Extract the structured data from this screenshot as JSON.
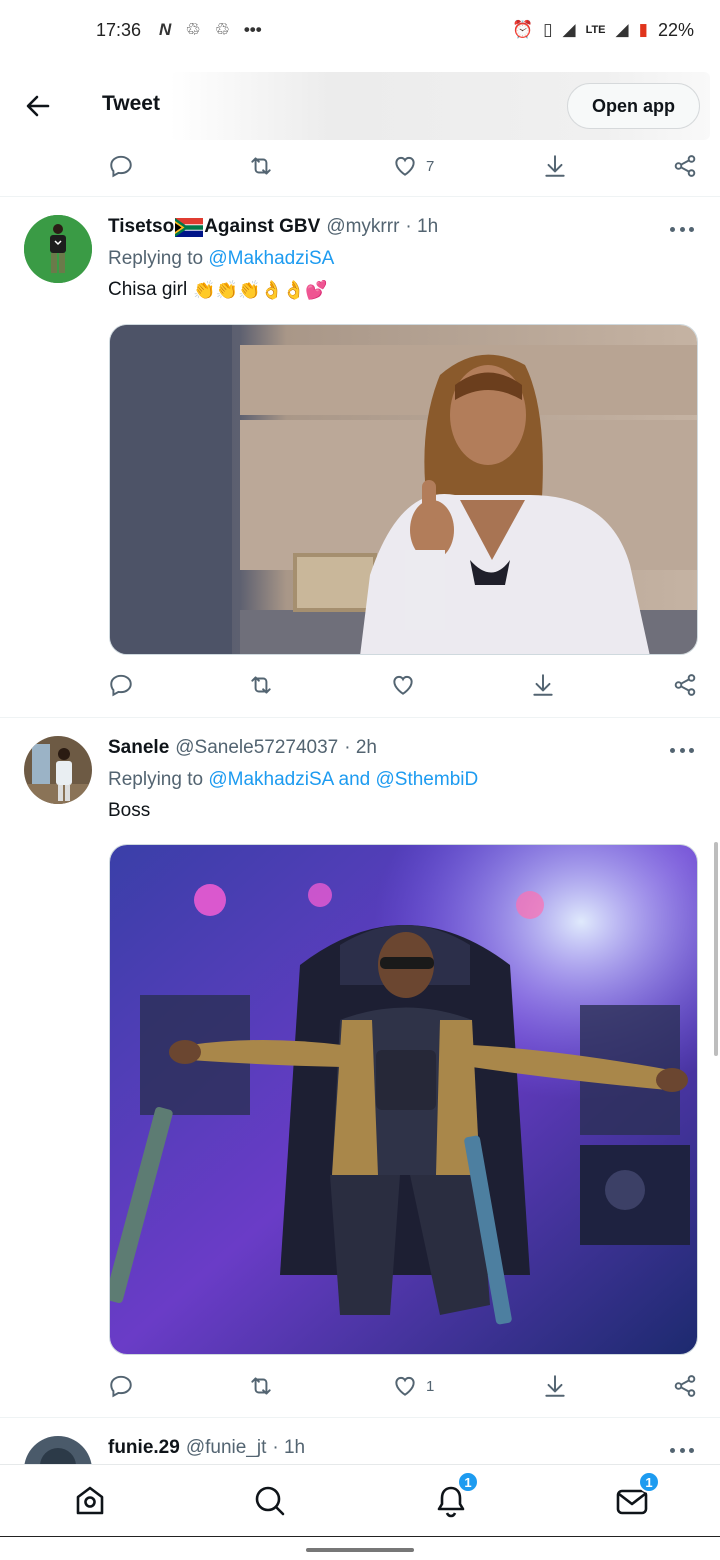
{
  "status_bar": {
    "time": "17:36",
    "network": "LTE",
    "battery": "22%"
  },
  "header": {
    "title": "Tweet",
    "open_app_label": "Open app"
  },
  "top_actions": {
    "like_count": "7"
  },
  "tweets": [
    {
      "name_part1": "Tisetso",
      "name_part2": "Against GBV",
      "handle": "@mykrrr",
      "time": "· 1h",
      "replying_prefix": "Replying to",
      "replying_to": "@MakhadziSA",
      "text": "Chisa girl",
      "emoji": "👏👏👏👌👌💕",
      "like_count": ""
    },
    {
      "name": "Sanele",
      "handle": "@Sanele57274037",
      "time": "· 2h",
      "replying_prefix": "Replying to",
      "replying_to": "@MakhadziSA and @SthembiD",
      "text": "Boss",
      "like_count": "1"
    },
    {
      "name": "funie.29",
      "handle": "@funie_jt",
      "time": "· 1h"
    }
  ],
  "bottom_nav": {
    "notifications_badge": "1",
    "messages_badge": "1"
  }
}
